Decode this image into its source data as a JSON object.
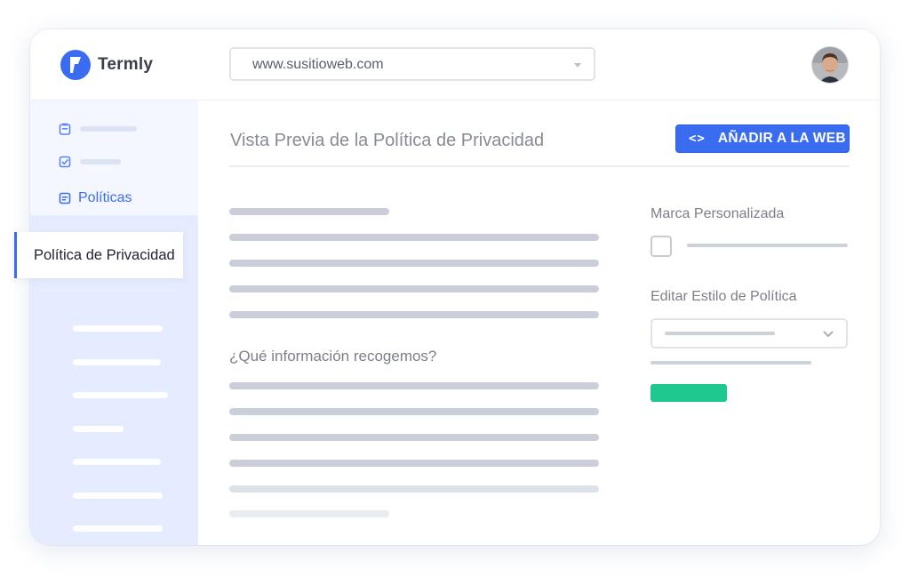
{
  "app": {
    "name": "Termly"
  },
  "header": {
    "url_value": "www.susitioweb.com",
    "avatar_alt": "user-avatar"
  },
  "sidebar": {
    "section_label": "Políticas",
    "active_item": "Política de Privacidad"
  },
  "main": {
    "title": "Vista Previa de la Política de Privacidad",
    "add_button_label": "AÑADIR A LA WEB",
    "add_button_icon": "<>",
    "section_heading": "¿Qué información recogemos?"
  },
  "panel": {
    "custom_brand_label": "Marca Personalizada",
    "custom_brand_checked": false,
    "edit_style_label": "Editar Estilo de Política"
  },
  "colors": {
    "brand": "#3a6cf2",
    "accent_green": "#1ec88f",
    "sidebar_bg": "#e6ecff"
  },
  "icons": [
    "termly-logo-icon",
    "clipboard-icon",
    "checkbox-icon",
    "document-icon",
    "code-icon",
    "chevron-down-icon",
    "caret-down-icon"
  ]
}
